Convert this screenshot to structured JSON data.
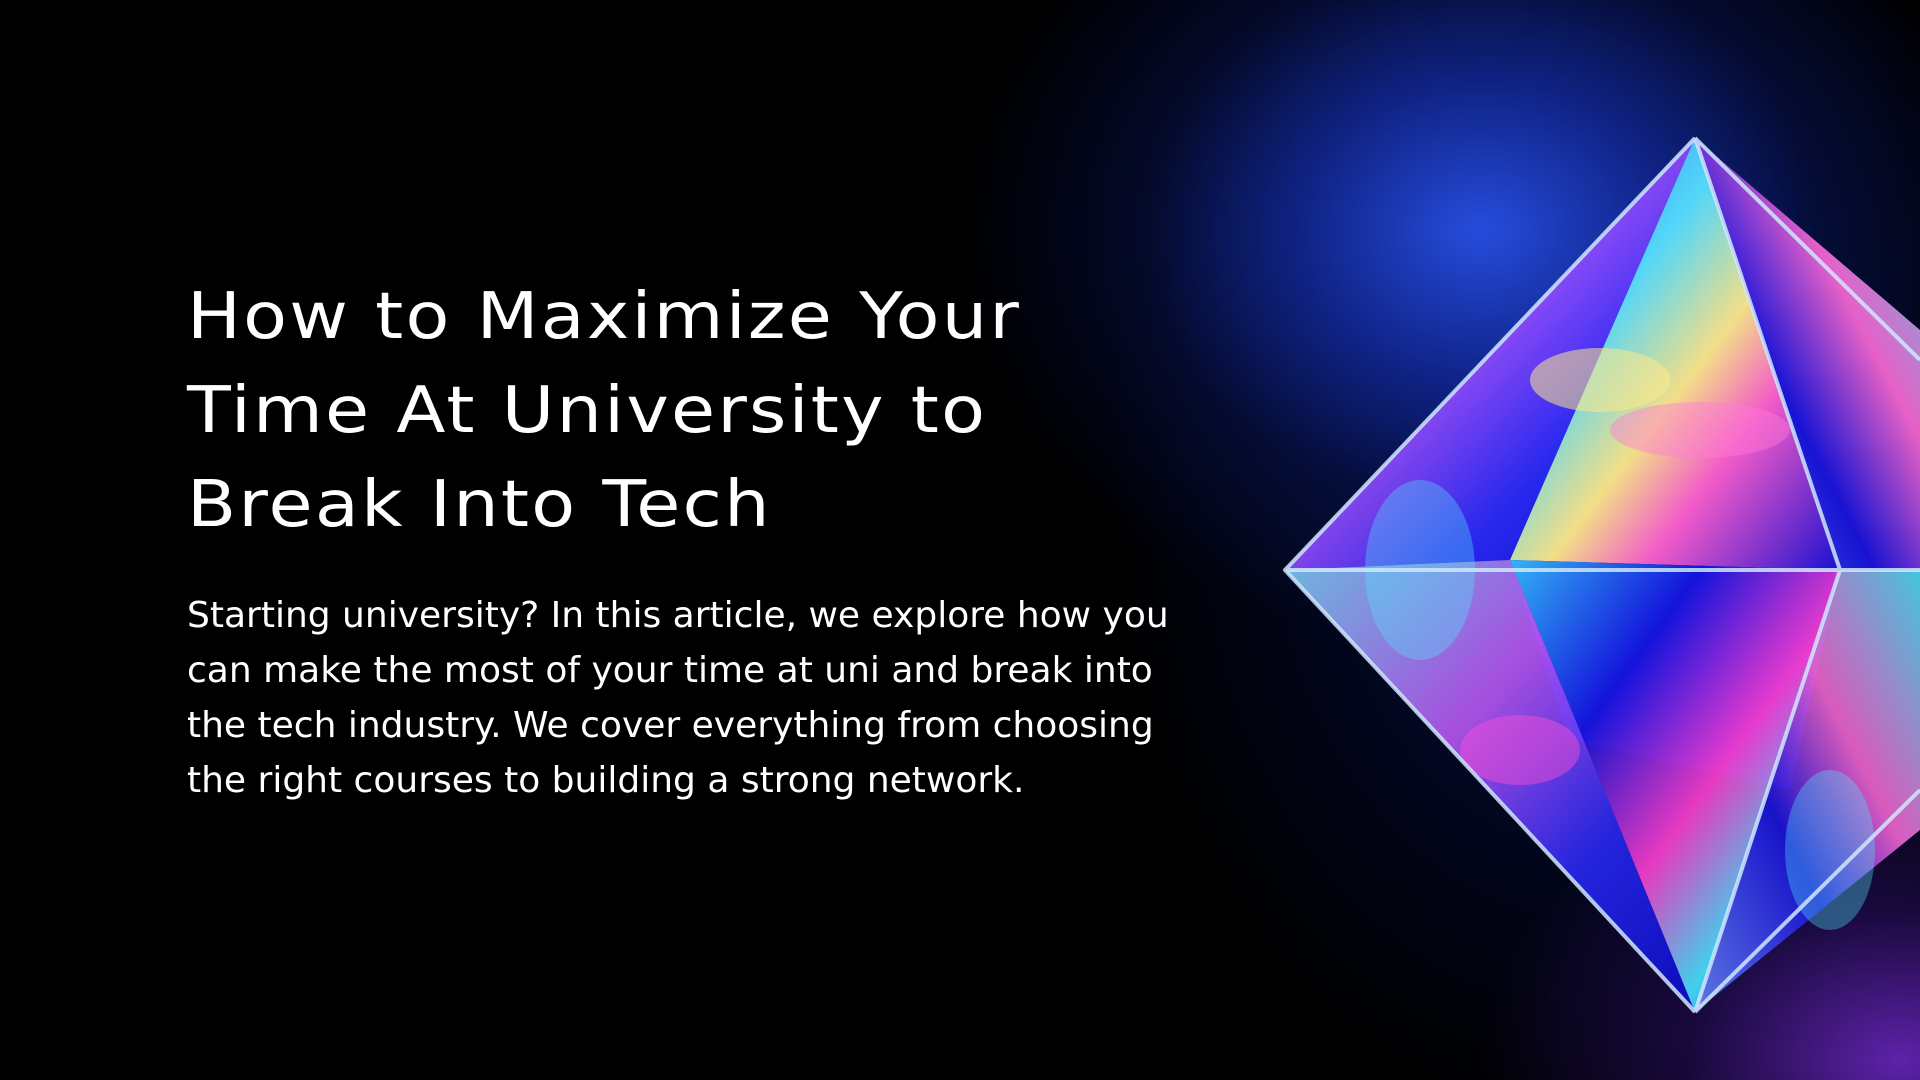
{
  "headline": "How to Maximize Your\nTime At University to\nBreak Into Tech",
  "intro": "Starting university? In this article, we explore how you can make the most of your time at uni and break into the tech industry. We cover everything from choosing the right courses to building a strong network.",
  "colors": {
    "background": "#000000",
    "glow_blue": "#2850e6",
    "glow_purple": "#6e28c8",
    "text": "#ffffff"
  },
  "crystal": {
    "icon": "octahedron-crystal-graphic"
  }
}
